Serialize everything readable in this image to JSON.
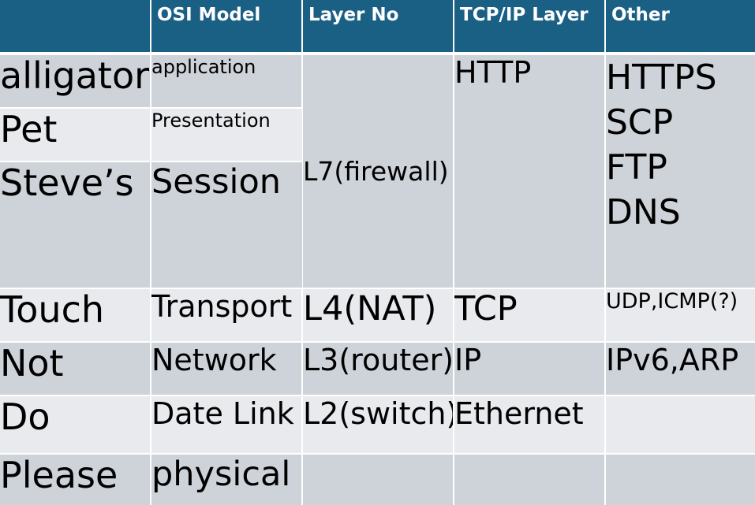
{
  "headers": [
    "",
    "OSI Model",
    "Layer No",
    "TCP/IP Layer",
    "Other"
  ],
  "mnemonics": [
    "alligator",
    "Pet",
    "Steve’s",
    "Touch",
    "Not",
    "Do",
    "Please"
  ],
  "osi_layers": [
    "application",
    "Presentation",
    "Session",
    "Transport",
    "Network",
    "Date Link",
    "physical"
  ],
  "layer_no": {
    "l7": "L7(firewall)",
    "l4": "L4(NAT)",
    "l3": "L3(router)",
    "l2": "L2(switch)"
  },
  "tcpip": {
    "app": "HTTP",
    "transport": "TCP",
    "network": "IP",
    "link": "Ethernet"
  },
  "other": {
    "app": [
      "HTTPS",
      "SCP",
      "FTP",
      "DNS"
    ],
    "transport": "UDP,ICMP(?)",
    "network": "IPv6,ARP"
  },
  "colors": {
    "header_bg": "#1a5f84",
    "row_dark": "#ced2d9",
    "row_light": "#e8eaed"
  }
}
